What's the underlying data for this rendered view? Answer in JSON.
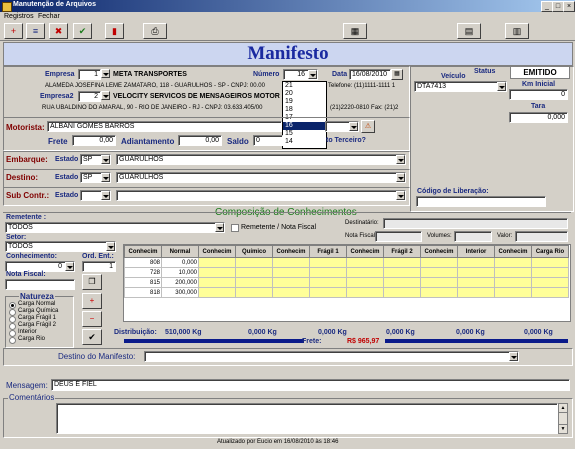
{
  "window": {
    "title": "Manutenção de Arquivos",
    "min": "_",
    "max": "□",
    "close": "×"
  },
  "menu": {
    "registros": "Registros",
    "fechar": "Fechar"
  },
  "toolbar": {
    "btn_new": "+",
    "btn_edit": "≡",
    "btn_delete": "✖",
    "btn_confirm": "✔",
    "btn_book": "▮",
    "btn_print": "⎙",
    "btn_calc": "▦",
    "btn_folder": "▤",
    "btn_doc": "▥"
  },
  "header": {
    "title": "Manifesto"
  },
  "empresa": {
    "label": "Empresa",
    "code": "1",
    "name": "META TRANSPORTES",
    "address": "ALAMEDA JOSEFINA LEME ZAMATARO, 118 - GUARULHOS - SP - CNPJ: 00.00",
    "phone": "Telefone: (11)1111-1111 1"
  },
  "empresa2": {
    "label": "Empresa2",
    "code": "2",
    "name": "VELOCITY SERVICOS DE MENSAGEIROS MOTOR",
    "address": "RUA UBALDINO DO AMARAL, 90 - RIO DE JANEIRO - RJ - CNPJ: 03.633.405/00",
    "phone": "(21)2220-0810 Fax: (21)2"
  },
  "numero": {
    "label": "Número",
    "value": "16",
    "options": [
      "21",
      "20",
      "19",
      "18",
      "17",
      "16",
      "15",
      "14"
    ],
    "selected_index": 5
  },
  "data": {
    "label": "Data",
    "value": "16/08/2010"
  },
  "status": {
    "label": "Status",
    "value": "EMITIDO"
  },
  "veiculo": {
    "label": "Veículo",
    "value": "DTA7413"
  },
  "km": {
    "label": "Km Inicial",
    "value": "0"
  },
  "tara": {
    "label": "Tara",
    "value": "0,000"
  },
  "motorista": {
    "label": "Motorista:",
    "value": "ALBANI GOMES BARROS"
  },
  "frete": {
    "label": "Frete",
    "value": "0,00"
  },
  "adiantamento": {
    "label": "Adiantamento",
    "value": "0,00"
  },
  "saldo": {
    "label": "Saldo",
    "value": "0",
    "terceiro": "to Terceiro?"
  },
  "embarque": {
    "label": "Embarque:",
    "estado_label": "Estado",
    "uf": "SP",
    "city": "GUARULHOS"
  },
  "destino": {
    "label": "Destino:",
    "estado_label": "Estado",
    "uf": "SP",
    "city": "GUARULHOS"
  },
  "subcontr": {
    "label": "Sub Contr.:",
    "estado_label": "Estado"
  },
  "codigo_liberacao": {
    "label": "Código de Liberação:"
  },
  "composicao": {
    "title": "Composição de Conhecimentos"
  },
  "remetente": {
    "label": "Remetente :",
    "value": "TODOS",
    "chk_label": "Remetente / Nota Fiscal"
  },
  "destinatario": {
    "label": "Destinatário:"
  },
  "nota_row": {
    "nota_label": "Nota Fiscal:",
    "volumes_label": "Volumes:",
    "valor_label": "Valor:"
  },
  "setor": {
    "label": "Setor:",
    "value": "TODOS"
  },
  "conhecimento": {
    "label": "Conhecimento:",
    "value": "0"
  },
  "ord_ent": {
    "label": "Ord. Ent.:",
    "value": "1"
  },
  "nota_fiscal": {
    "label": "Nota Fiscal:"
  },
  "natureza": {
    "title": "Natureza",
    "options": [
      "Carga Normal",
      "Carga Química",
      "Carga Frágil 1",
      "Carga Frágil 2",
      "Interior",
      "Carga Rio"
    ],
    "selected": 0
  },
  "grid": {
    "headers": [
      "Conhecim",
      "Normal",
      "Conhecim",
      "Químico",
      "Conhecim",
      "Frágil 1",
      "Conhecim",
      "Frágil 2",
      "Conhecim",
      "Interior",
      "Conhecim",
      "Carga Rio"
    ],
    "rows": [
      [
        "808",
        "0,000"
      ],
      [
        "728",
        "10,000"
      ],
      [
        "815",
        "200,000"
      ],
      [
        "818",
        "300,000"
      ]
    ]
  },
  "distribuicao": {
    "label": "Distribuição:",
    "values": [
      "510,000 Kg",
      "0,000 Kg",
      "0,000 Kg",
      "0,000 Kg",
      "0,000 Kg",
      "0,000 Kg"
    ],
    "frete_label": "Frete:",
    "frete_value": "R$ 965,97"
  },
  "destino_manifesto": {
    "label": "Destino do Manifesto:"
  },
  "mensagem": {
    "label": "Mensagem:",
    "value": "DEUS É FIEL"
  },
  "comentarios": {
    "label": "Comentários"
  },
  "footer": {
    "text": "Atualizado por Eucio em 16/08/2010 às 18:46"
  }
}
